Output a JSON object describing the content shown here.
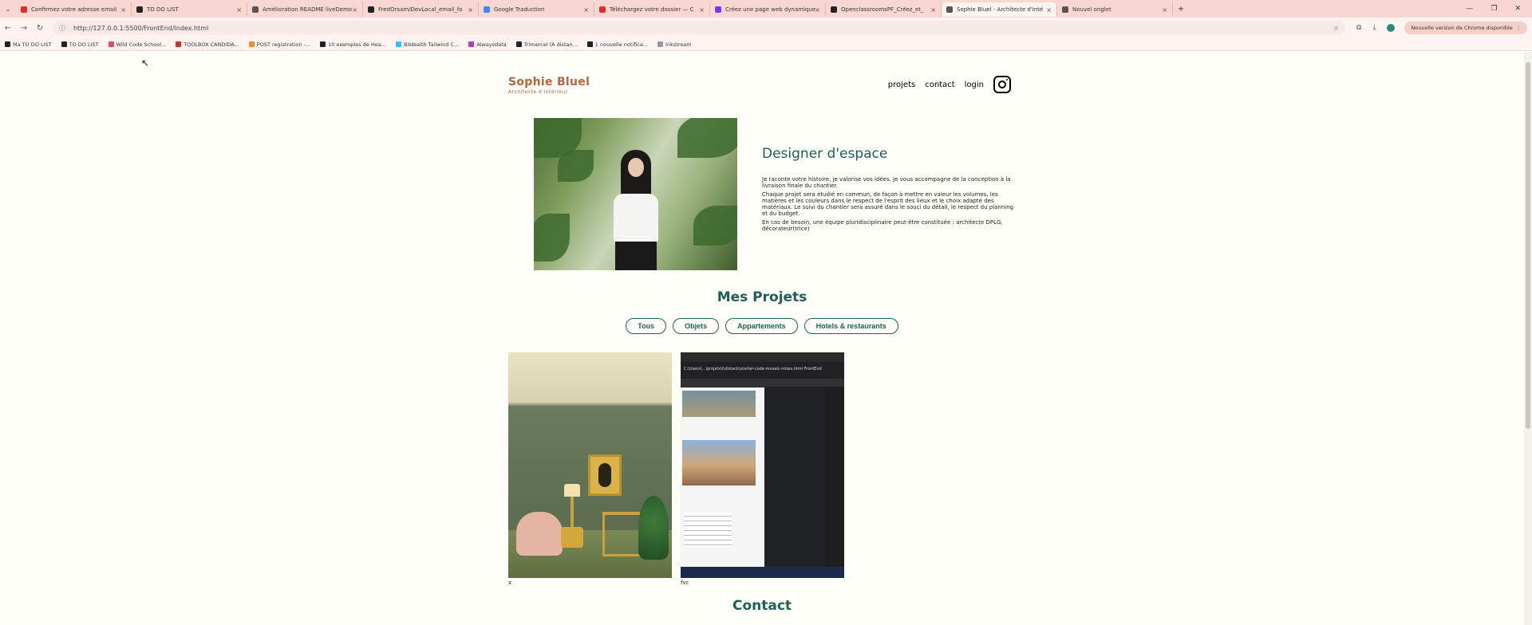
{
  "browser": {
    "tabs": [
      {
        "label": "Confirmez votre adresse email",
        "color": "#d93025"
      },
      {
        "label": "TO DO LIST",
        "color": "#222222"
      },
      {
        "label": "Amélioration README liveDemo",
        "color": "#555555"
      },
      {
        "label": "FredOrsam/DevLocal_email_fo",
        "color": "#222222"
      },
      {
        "label": "Google Traduction",
        "color": "#4285f4"
      },
      {
        "label": "Téléchargez votre dossier — C",
        "color": "#d93025"
      },
      {
        "label": "Créez une page web dynamique",
        "color": "#6c3cf0"
      },
      {
        "label": "OpenclassroomsPF_Créez_et_",
        "color": "#222222"
      },
      {
        "label": "Sophie Bluel - Architecte d'inté",
        "color": "#555555",
        "active": true
      },
      {
        "label": "Nouvel onglet",
        "color": "#555555"
      }
    ],
    "url": "http://127.0.0.1:5500/FrontEnd/index.html",
    "update_label": "Nouvelle version de Chrome disponible",
    "bookmarks": [
      {
        "label": "Ma TO DO LIST",
        "color": "#222222"
      },
      {
        "label": "TO DO LIST",
        "color": "#222222"
      },
      {
        "label": "Wild Code School...",
        "color": "#e64a6b"
      },
      {
        "label": "TOOLBOX CANDIDA...",
        "color": "#d93025"
      },
      {
        "label": "POST registration -...",
        "color": "#f28b30"
      },
      {
        "label": "10 exemples de Hea...",
        "color": "#222222"
      },
      {
        "label": "Bildealth Tailwind C...",
        "color": "#38bdf8"
      },
      {
        "label": "Alwaysdata",
        "color": "#b03cc8"
      },
      {
        "label": "Trimercel (À distan...",
        "color": "#222222"
      },
      {
        "label": "1 nouvelle notifica...",
        "color": "#222222"
      },
      {
        "label": "Inkstream",
        "color": "#999999"
      }
    ]
  },
  "site": {
    "logo": "Sophie Bluel",
    "logo_subtitle": "Architecte d'intérieur",
    "nav": {
      "projects": "projets",
      "contact": "contact",
      "login": "login"
    },
    "intro": {
      "title": "Designer d'espace",
      "paragraphs": [
        "Je raconte votre histoire, je valorise vos idées. Je vous accompagne de la conception à la livraison finale du chantier.",
        "Chaque projet sera étudié en commun, de façon à mettre en valeur les volumes, les matières et les couleurs dans le respect de l'esprit des lieux et le choix adapté des matériaux. Le suivi du chantier sera assuré dans le souci du détail, le respect du planning et du budget.",
        "En cas de besoin, une équipe pluridisciplinaire peut-être constituée : architecte DPLG, décorateur(trice)"
      ]
    },
    "projects_title": "Mes Projets",
    "filters": [
      "Tous",
      "Objets",
      "Appartements",
      "Hotels & restaurants"
    ],
    "works": [
      {
        "caption": "x"
      },
      {
        "caption": "fvc"
      }
    ],
    "contact_title": "Contact",
    "screenshot_path": "C:\\Users\\...\\projets\\fullstack\\starter-code-mosaic-notes.html FrontEnd"
  },
  "colors": {
    "accent": "#1d6154",
    "logo": "#b1663c",
    "tabbar": "#f8d7d2"
  }
}
